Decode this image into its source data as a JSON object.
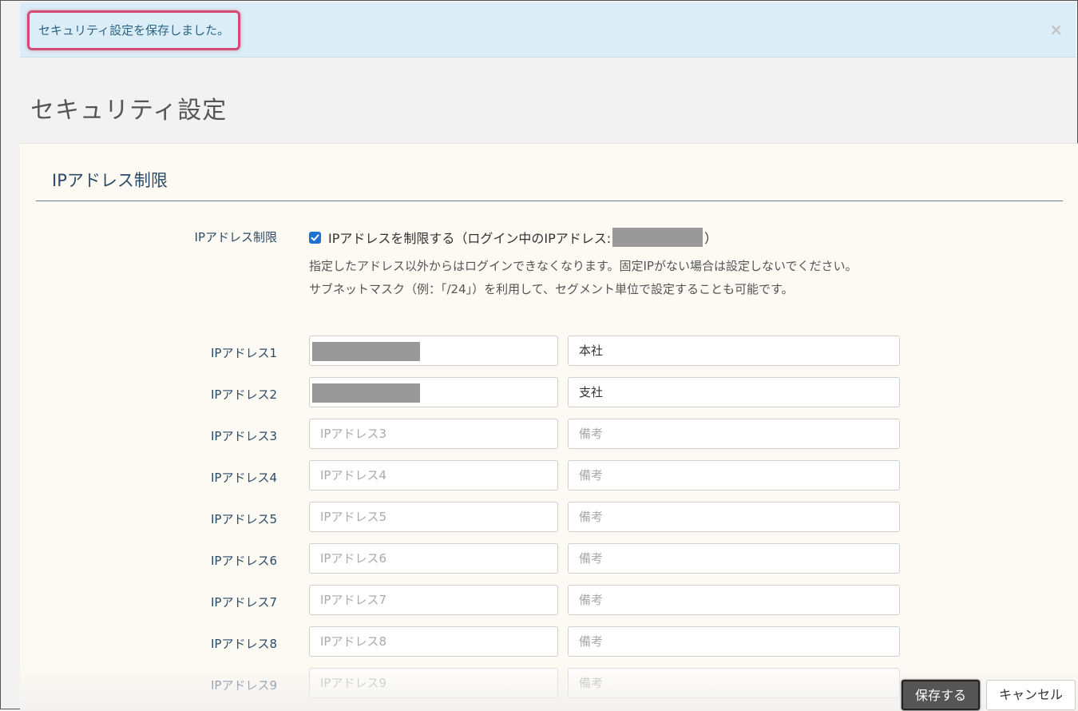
{
  "alert": {
    "message": "セキュリティ設定を保存しました。",
    "close_glyph": "×"
  },
  "page": {
    "title": "セキュリティ設定"
  },
  "section": {
    "title": "IPアドレス制限",
    "field_label": "IPアドレス制限",
    "checkbox_checked": true,
    "checkbox_label_prefix": "IPアドレスを制限する（ログイン中のIPアドレス:",
    "checkbox_label_suffix": "）",
    "help_line1": "指定したアドレス以外からはログインできなくなります。固定IPがない場合は設定しないでください。",
    "help_line2": "サブネットマスク（例：「/24」）を利用して、セグメント単位で設定することも可能です。"
  },
  "rows": [
    {
      "label": "IPアドレス1",
      "ip_value": "",
      "ip_placeholder": "",
      "ip_redacted": true,
      "note_value": "本社",
      "note_placeholder": ""
    },
    {
      "label": "IPアドレス2",
      "ip_value": "",
      "ip_placeholder": "",
      "ip_redacted": true,
      "note_value": "支社",
      "note_placeholder": ""
    },
    {
      "label": "IPアドレス3",
      "ip_value": "",
      "ip_placeholder": "IPアドレス3",
      "note_value": "",
      "note_placeholder": "備考"
    },
    {
      "label": "IPアドレス4",
      "ip_value": "",
      "ip_placeholder": "IPアドレス4",
      "note_value": "",
      "note_placeholder": "備考"
    },
    {
      "label": "IPアドレス5",
      "ip_value": "",
      "ip_placeholder": "IPアドレス5",
      "note_value": "",
      "note_placeholder": "備考"
    },
    {
      "label": "IPアドレス6",
      "ip_value": "",
      "ip_placeholder": "IPアドレス6",
      "note_value": "",
      "note_placeholder": "備考"
    },
    {
      "label": "IPアドレス7",
      "ip_value": "",
      "ip_placeholder": "IPアドレス7",
      "note_value": "",
      "note_placeholder": "備考"
    },
    {
      "label": "IPアドレス8",
      "ip_value": "",
      "ip_placeholder": "IPアドレス8",
      "note_value": "",
      "note_placeholder": "備考"
    },
    {
      "label": "IPアドレス9",
      "ip_value": "",
      "ip_placeholder": "IPアドレス9",
      "note_value": "",
      "note_placeholder": "備考"
    }
  ],
  "buttons": {
    "save": "保存する",
    "cancel": "キャンセル"
  }
}
